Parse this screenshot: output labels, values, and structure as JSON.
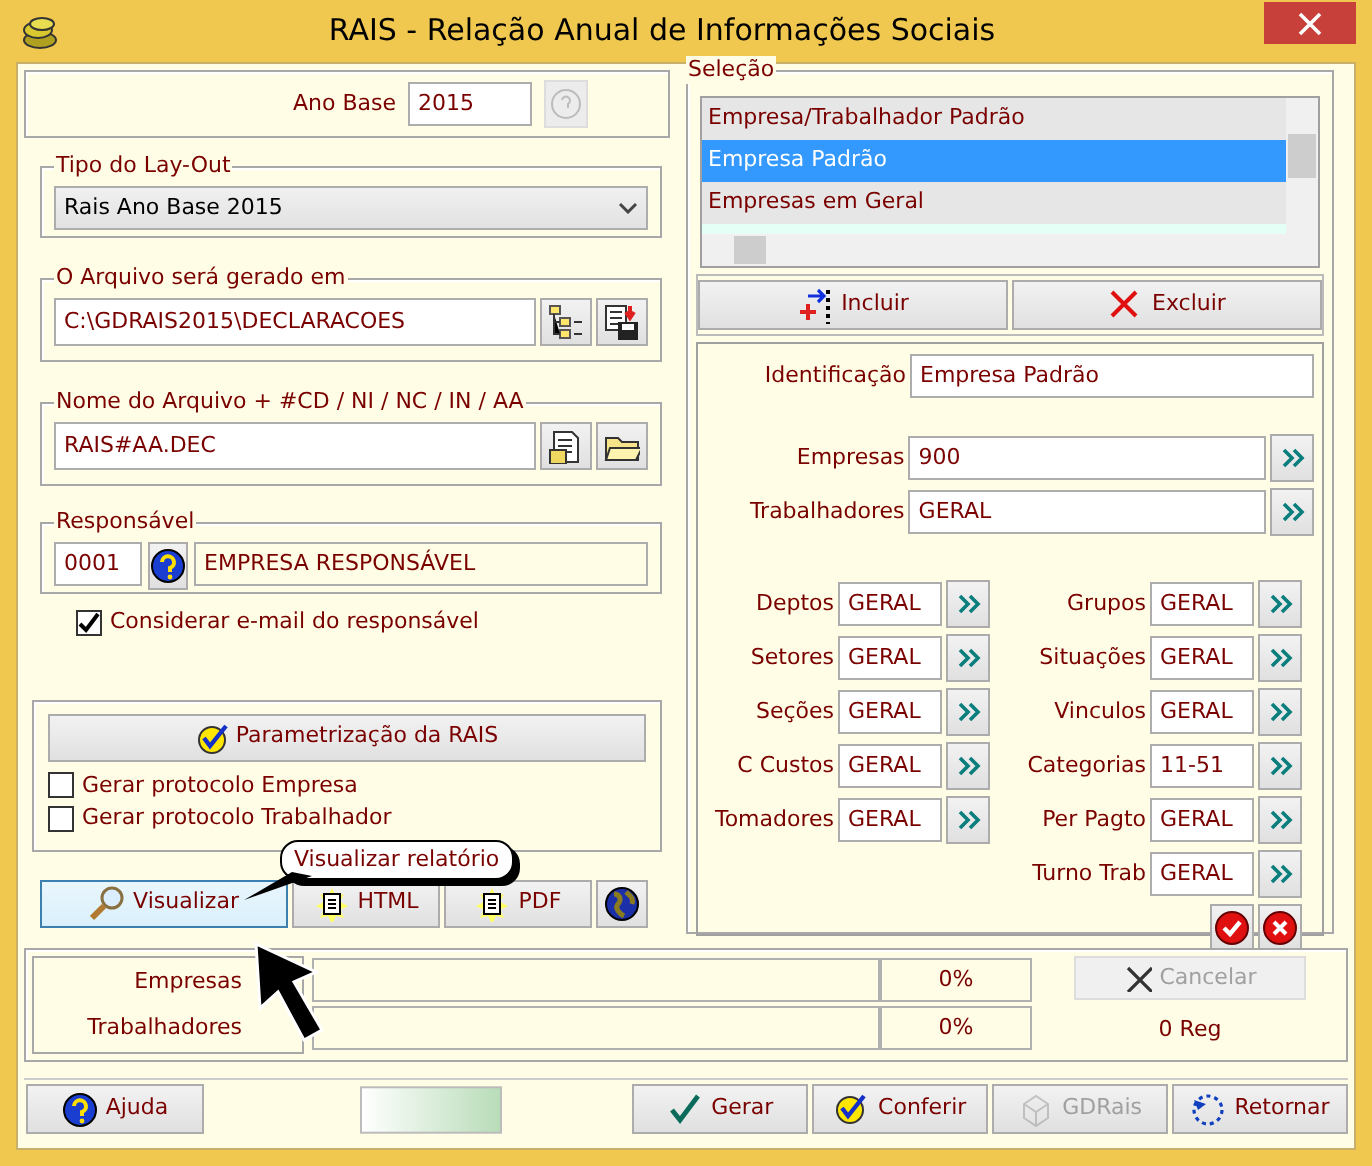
{
  "window": {
    "title": "RAIS - Relação Anual de Informações Sociais"
  },
  "ano_base": {
    "label": "Ano Base",
    "value": "2015"
  },
  "layout": {
    "legend": "Tipo do Lay-Out",
    "value": "Rais Ano Base 2015"
  },
  "arquivo": {
    "legend": "O Arquivo será gerado em",
    "value": "C:\\GDRAIS2015\\DECLARACOES"
  },
  "nome": {
    "legend": "Nome do Arquivo + #CD / NI / NC / IN / AA",
    "value": "RAIS#AA.DEC"
  },
  "responsavel": {
    "legend": "Responsável",
    "code": "0001",
    "name": "EMPRESA RESPONSÁVEL"
  },
  "email_checkbox": {
    "label": "Considerar e-mail do responsável",
    "checked": true
  },
  "param_button": "Parametrização da RAIS",
  "protocol_checkboxes": [
    {
      "label": "Gerar protocolo Empresa",
      "checked": false
    },
    {
      "label": "Gerar protocolo Trabalhador",
      "checked": false
    }
  ],
  "output_buttons": [
    {
      "label": "Visualizar",
      "hover": true
    },
    {
      "label": "HTML",
      "hover": false
    },
    {
      "label": "PDF",
      "hover": false
    }
  ],
  "tooltip": "Visualizar relatório",
  "selecao": {
    "legend": "Seleção",
    "items": [
      {
        "label": "Empresa/Trabalhador Padrão",
        "selected": false
      },
      {
        "label": "Empresa Padrão",
        "selected": true
      },
      {
        "label": "Empresas em Geral",
        "selected": false
      }
    ],
    "buttons": [
      "Incluir",
      "Excluir"
    ]
  },
  "identificacao": {
    "label": "Identificação",
    "value": "Empresa Padrão"
  },
  "wide_filters": [
    {
      "label": "Empresas",
      "value": "900"
    },
    {
      "label": "Trabalhadores",
      "value": "GERAL"
    }
  ],
  "filters_left": [
    {
      "label": "Deptos",
      "value": "GERAL"
    },
    {
      "label": "Setores",
      "value": "GERAL"
    },
    {
      "label": "Seções",
      "value": "GERAL"
    },
    {
      "label": "C Custos",
      "value": "GERAL"
    },
    {
      "label": "Tomadores",
      "value": "GERAL"
    }
  ],
  "filters_right": [
    {
      "label": "Grupos",
      "value": "GERAL"
    },
    {
      "label": "Situações",
      "value": "GERAL"
    },
    {
      "label": "Vinculos",
      "value": "GERAL"
    },
    {
      "label": "Categorias",
      "value": "11-51"
    },
    {
      "label": "Per Pagto",
      "value": "GERAL"
    },
    {
      "label": "Turno Trab",
      "value": "GERAL"
    }
  ],
  "progress": {
    "rows": [
      {
        "label": "Empresas",
        "level": 0,
        "reading": "0%"
      },
      {
        "label": "Trabalhadores",
        "level": 0,
        "reading": "0%"
      }
    ],
    "cancel": {
      "label": "Cancelar",
      "disabled": true
    },
    "count": "0 Reg"
  },
  "footer": {
    "help": "Ajuda",
    "buttons": [
      {
        "label": "Gerar",
        "disabled": false
      },
      {
        "label": "Conferir",
        "disabled": false
      },
      {
        "label": "GDRais",
        "disabled": true
      },
      {
        "label": "Retornar",
        "disabled": false
      }
    ]
  }
}
